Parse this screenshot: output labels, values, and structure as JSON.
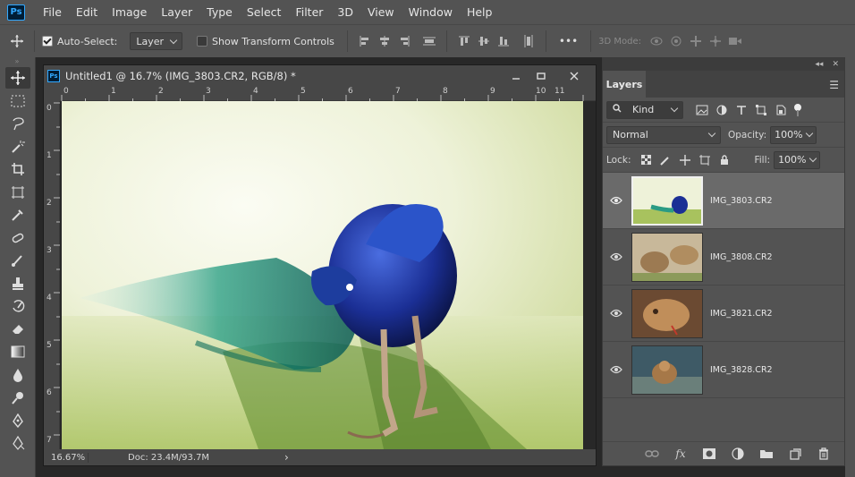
{
  "menu": [
    "File",
    "Edit",
    "Image",
    "Layer",
    "Type",
    "Select",
    "Filter",
    "3D",
    "View",
    "Window",
    "Help"
  ],
  "app_logo": "Ps",
  "options": {
    "auto_select_label": "Auto-Select:",
    "auto_select_checked": true,
    "auto_select_target": "Layer",
    "show_transform_label": "Show Transform Controls",
    "show_transform_checked": false,
    "more": "•••",
    "mode3d_label": "3D Mode:"
  },
  "document": {
    "title": "Untitled1 @ 16.7% (IMG_3803.CR2, RGB/8) *",
    "ruler_h": [
      "0",
      "1",
      "2",
      "3",
      "4",
      "5",
      "6",
      "7",
      "8",
      "9",
      "10",
      "11"
    ],
    "ruler_v": [
      "0",
      "1",
      "2",
      "3",
      "4",
      "5",
      "6",
      "7"
    ],
    "zoom": "16.67%",
    "doc_info": "Doc: 23.4M/93.7M",
    "status_arrow": "›"
  },
  "layers_panel": {
    "tab": "Layers",
    "filter_kind": "Kind",
    "blend_mode": "Normal",
    "opacity_label": "Opacity:",
    "opacity": "100%",
    "lock_label": "Lock:",
    "fill_label": "Fill:",
    "fill": "100%",
    "layers": [
      {
        "name": "IMG_3803.CR2",
        "selected": true,
        "thumb": "peacock"
      },
      {
        "name": "IMG_3808.CR2",
        "selected": false,
        "thumb": "lions"
      },
      {
        "name": "IMG_3821.CR2",
        "selected": false,
        "thumb": "lioncub"
      },
      {
        "name": "IMG_3828.CR2",
        "selected": false,
        "thumb": "animal"
      }
    ]
  },
  "colors": {
    "accent": "#31a8ff",
    "panel": "#535353",
    "dark": "#282828"
  }
}
